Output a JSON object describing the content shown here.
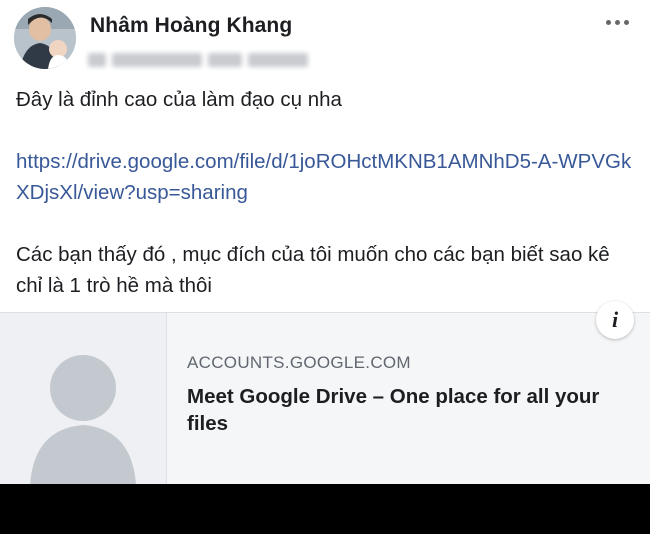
{
  "post": {
    "author_name": "Nhâm Hoàng Khang",
    "more_icon": "more-horizontal-icon",
    "text_line_1": "Đây là đỉnh cao của làm đạo cụ nha",
    "link_text": "https://drive.google.com/file/d/1joROHctMKNB1AMNhD5-A-WPVGkXDjsXl/view?usp=sharing",
    "text_line_2": "Các bạn thấy đó , mục đích của tôi muốn cho các bạn biết sao kê chỉ là 1 trò hề mà thôi"
  },
  "link_preview": {
    "thumbnail_icon": "default-user-silhouette-icon",
    "domain": "ACCOUNTS.GOOGLE.COM",
    "title": "Meet Google Drive – One place for all your files",
    "info_icon": "info-icon",
    "info_glyph": "i"
  },
  "colors": {
    "link": "#385898",
    "text": "#1c1e21",
    "muted": "#606770",
    "card_bg": "#f5f6f7",
    "bottom_bar": "#000000"
  }
}
